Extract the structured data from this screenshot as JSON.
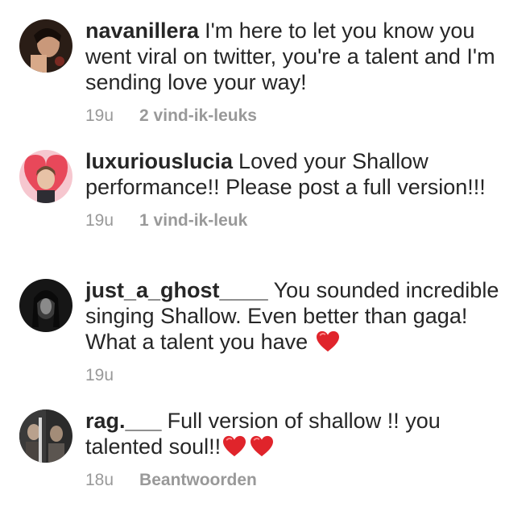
{
  "comments": [
    {
      "username": "navanillera",
      "text": "I'm here to let you know you went viral on twitter, you're a talent and I'm sending love your way!",
      "time": "19u",
      "action": "2 vind-ik-leuks"
    },
    {
      "username": "luxuriouslucia",
      "text": "Loved your Shallow performance!! Please post a full version!!!",
      "time": "19u",
      "action": "1 vind-ik-leuk"
    },
    {
      "username": "just_a_ghost____",
      "text": "You sounded incredible singing Shallow. Even better than gaga! What a talent you have",
      "time": "19u",
      "action": ""
    },
    {
      "username": "rag.___",
      "text": "Full version of shallow !! you talented soul!!",
      "time": "18u",
      "action": "Beantwoorden"
    }
  ],
  "colors": {
    "text": "#262626",
    "meta": "#999999",
    "heart": "#e0242b"
  },
  "icons": {
    "emoji": "red-heart-icon"
  }
}
